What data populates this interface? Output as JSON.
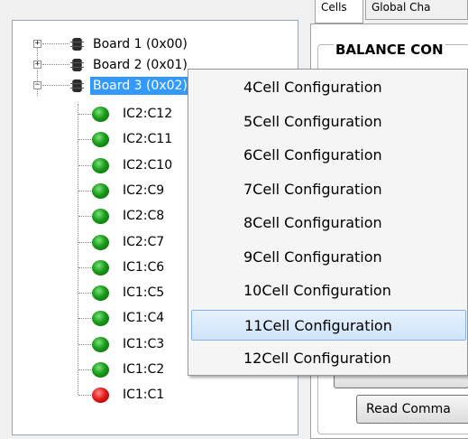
{
  "tree": {
    "boards": [
      {
        "label": "Board 1 (0x00)",
        "expander": "+"
      },
      {
        "label": "Board 2 (0x01)",
        "expander": "+"
      },
      {
        "label": "Board 3 (0x02)",
        "expander": "−"
      }
    ],
    "cells": [
      {
        "label": "IC2:C12",
        "status": "green"
      },
      {
        "label": "IC2:C11",
        "status": "green"
      },
      {
        "label": "IC2:C10",
        "status": "green"
      },
      {
        "label": "IC2:C9",
        "status": "green"
      },
      {
        "label": "IC2:C8",
        "status": "green"
      },
      {
        "label": "IC2:C7",
        "status": "green"
      },
      {
        "label": "IC1:C6",
        "status": "green"
      },
      {
        "label": "IC1:C5",
        "status": "green"
      },
      {
        "label": "IC1:C4",
        "status": "green"
      },
      {
        "label": "IC1:C3",
        "status": "green"
      },
      {
        "label": "IC1:C2",
        "status": "green"
      },
      {
        "label": "IC1:C1",
        "status": "red"
      }
    ]
  },
  "tabs": [
    {
      "label": "Cells"
    },
    {
      "label": "Global Cha"
    }
  ],
  "groupbox": {
    "title": "BALANCE CON"
  },
  "read_button": {
    "label": "Read Comma"
  },
  "context_menu": {
    "items": [
      {
        "label": "4Cell Configuration"
      },
      {
        "label": "5Cell Configuration"
      },
      {
        "label": "6Cell Configuration"
      },
      {
        "label": "7Cell Configuration"
      },
      {
        "label": "8Cell Configuration"
      },
      {
        "label": "9Cell Configuration"
      },
      {
        "label": "10Cell Configuration"
      },
      {
        "label": "11Cell Configuration"
      },
      {
        "label": "12Cell Configuration"
      }
    ],
    "highlighted_index": 7
  },
  "colors": {
    "selection": "#3399ff",
    "ok_status": "#1a9b1a",
    "fault_status": "#e41b1b",
    "menu_highlight": "#cfe4fa"
  }
}
